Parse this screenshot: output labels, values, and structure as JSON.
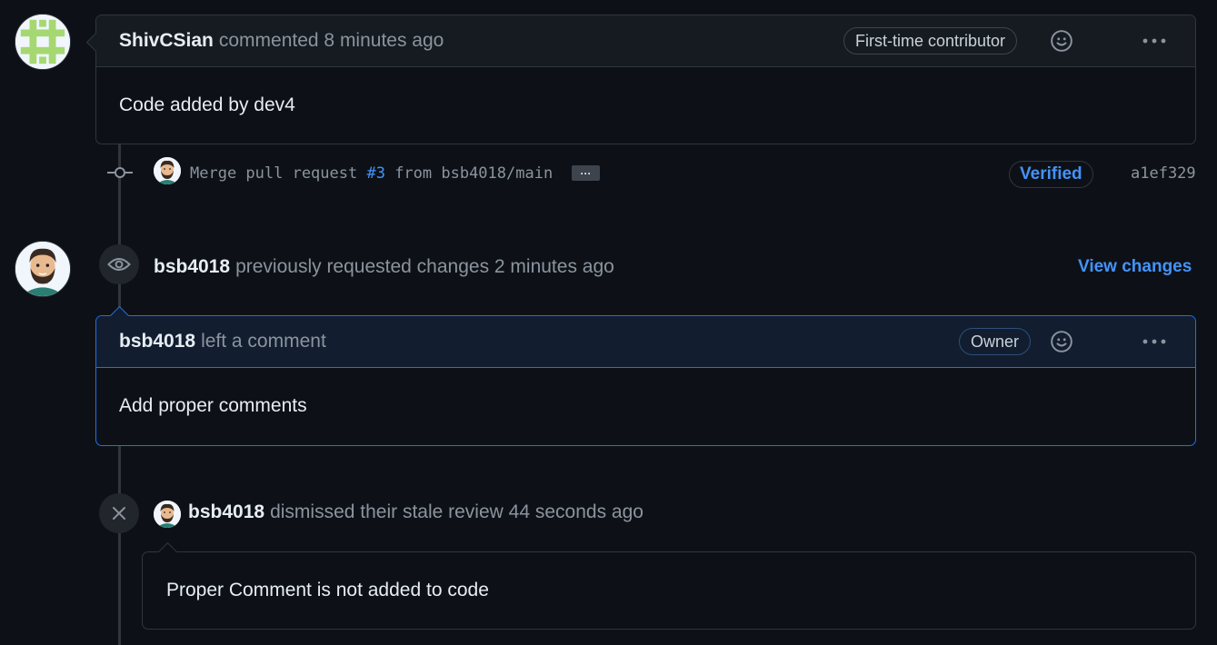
{
  "comment1": {
    "author": "ShivCSian",
    "action": "commented 8 minutes ago",
    "label": "First-time contributor",
    "body": "Code added by dev4"
  },
  "commit": {
    "message_prefix": "Merge pull request ",
    "pr_ref": "#3",
    "message_suffix": " from bsb4018/main",
    "expand_label": "···",
    "verified_label": "Verified",
    "sha": "a1ef329"
  },
  "review_event": {
    "author": "bsb4018",
    "action": "previously requested changes 2 minutes ago",
    "view_changes_label": "View changes"
  },
  "comment2": {
    "author": "bsb4018",
    "action": "left a comment",
    "label": "Owner",
    "body": "Add proper comments"
  },
  "dismiss_event": {
    "author": "bsb4018",
    "action": "dismissed their stale review 44 seconds ago",
    "message": "Proper Comment is not added to code"
  },
  "colors": {
    "background": "#0d1117",
    "header": "#161b22",
    "owner_header": "#121d2f",
    "accent": "#4493f8",
    "border": "#30363d"
  },
  "icons": [
    "identicon-avatar",
    "user-avatar",
    "smiley-icon",
    "kebab-icon",
    "commit-icon",
    "eye-icon",
    "x-icon"
  ]
}
